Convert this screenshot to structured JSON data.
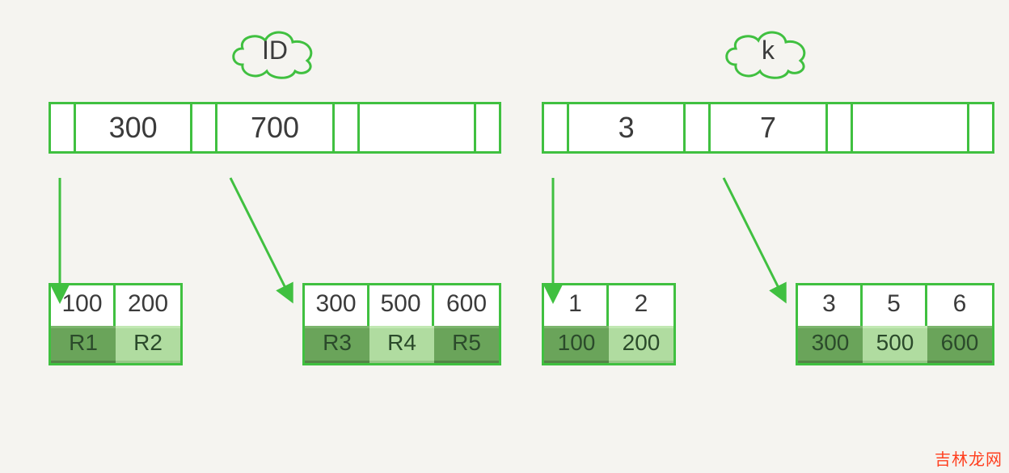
{
  "left": {
    "label": "ID",
    "root_keys": [
      "300",
      "700",
      ""
    ],
    "leaves": [
      {
        "keys": [
          "100",
          "200"
        ],
        "vals": [
          "R1",
          "R2"
        ]
      },
      {
        "keys": [
          "300",
          "500",
          "600"
        ],
        "vals": [
          "R3",
          "R4",
          "R5"
        ]
      }
    ]
  },
  "right": {
    "label": "k",
    "root_keys": [
      "3",
      "7",
      ""
    ],
    "leaves": [
      {
        "keys": [
          "1",
          "2"
        ],
        "vals": [
          "100",
          "200"
        ]
      },
      {
        "keys": [
          "3",
          "5",
          "6"
        ],
        "vals": [
          "300",
          "500",
          "600"
        ]
      }
    ]
  },
  "watermark": "吉林龙网"
}
